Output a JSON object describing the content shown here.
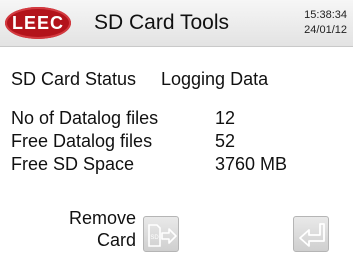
{
  "header": {
    "logo_text": "LEEC",
    "title": "SD Card Tools",
    "time": "15:38:34",
    "date": "24/01/12"
  },
  "status": {
    "label": "SD Card Status",
    "value": "Logging Data"
  },
  "stats": [
    {
      "label": "No of Datalog files",
      "value": "12"
    },
    {
      "label": "Free Datalog files",
      "value": "52"
    },
    {
      "label": "Free SD Space",
      "value": "3760 MB"
    }
  ],
  "buttons": {
    "remove_card_line1": "Remove",
    "remove_card_line2": "Card",
    "remove_card_icon": "sd-card-arrow-icon",
    "sd_icon_text": "SD",
    "back_icon": "return-arrow-icon"
  },
  "colors": {
    "logo_red": "#b3131b",
    "header_bg": "#ececec",
    "icon_gray": "#ffffff"
  }
}
